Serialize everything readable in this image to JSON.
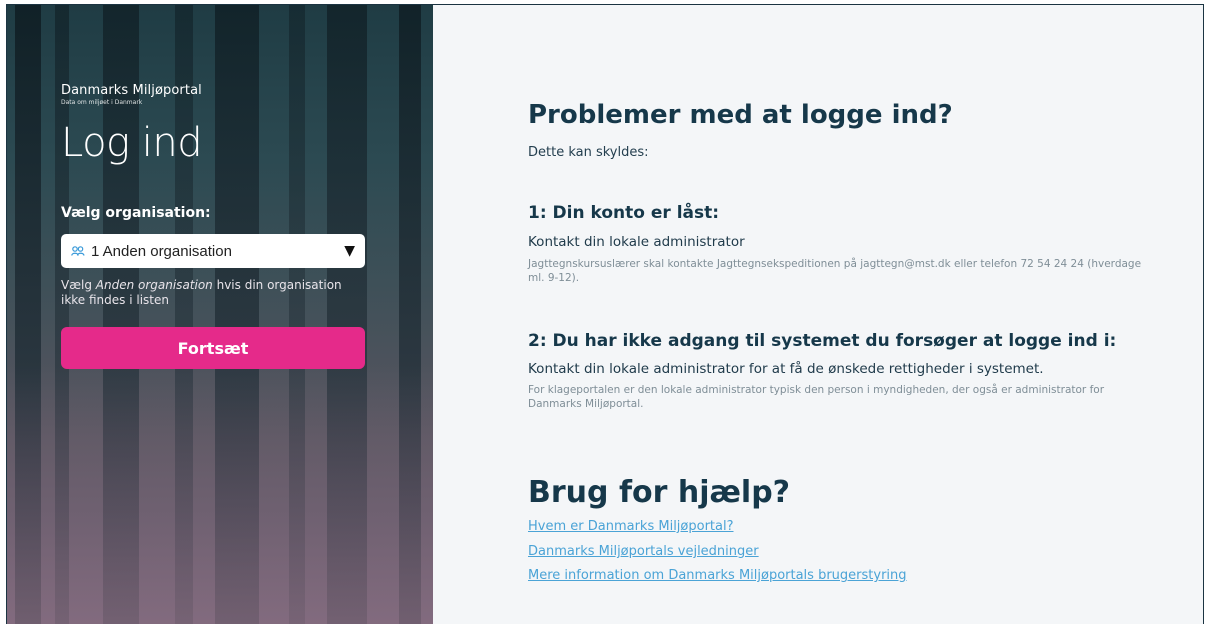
{
  "login": {
    "brand_name": "Danmarks Miljøportal",
    "brand_tagline": "Data om miljøet i Danmark",
    "title": "Log ind",
    "org_label": "Vælg organisation:",
    "org_selected": "1 Anden organisation",
    "org_help_prefix": "Vælg ",
    "org_help_emph": "Anden organisation",
    "org_help_suffix": " hvis din organisation ikke findes i listen",
    "continue_label": "Fortsæt",
    "accent_color": "#e52a8a"
  },
  "problems": {
    "heading": "Problemer med at logge ind?",
    "intro": "Dette kan skyldes:",
    "items": [
      {
        "heading": "1: Din konto er låst:",
        "text": "Kontakt din lokale administrator",
        "note": "Jagttegnskursuslærer skal kontakte Jagttegnsekspeditionen på jagttegn@mst.dk eller telefon 72 54 24 24 (hverdage ml. 9-12)."
      },
      {
        "heading": "2: Du har ikke adgang til systemet du forsøger at logge ind i:",
        "text": "Kontakt din lokale administrator for at få de ønskede rettigheder i systemet.",
        "note": "For klageportalen er den lokale administrator typisk den person i myndigheden, der også er administrator for Danmarks Miljøportal."
      }
    ]
  },
  "help": {
    "heading": "Brug for hjælp?",
    "links": [
      "Hvem er Danmarks Miljøportal?",
      "Danmarks Miljøportals vejledninger",
      "Mere information om Danmarks Miljøportals brugerstyring"
    ]
  }
}
